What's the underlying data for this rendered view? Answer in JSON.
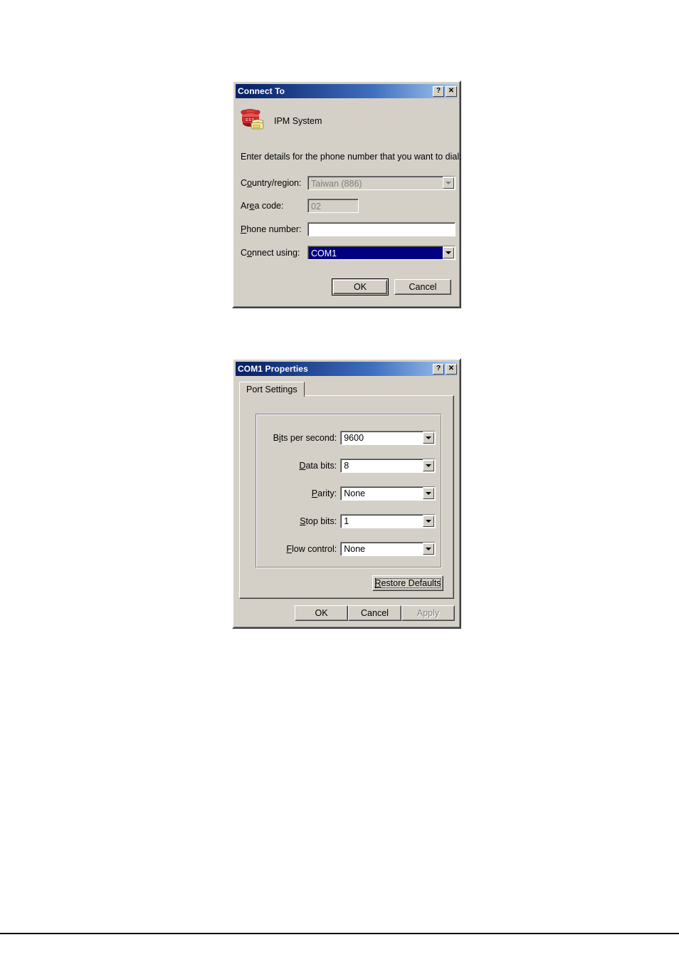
{
  "connect_dialog": {
    "title": "Connect To",
    "help_button": "?",
    "close_button": "✕",
    "icon_name": "telephone-dialup-icon",
    "connection_name": "IPM System",
    "instruction": "Enter details for the phone number that you want to dial:",
    "fields": [
      {
        "name": "country-region",
        "label_before": "C",
        "label_accel": "o",
        "label_after": "untry/region:",
        "value": "Taiwan (886)",
        "control": "combo",
        "state": "disabled"
      },
      {
        "name": "area-code",
        "label_before": "Ar",
        "label_accel": "e",
        "label_after": "a code:",
        "value": "02",
        "control": "text",
        "state": "disabled"
      },
      {
        "name": "phone-number",
        "label_before": "",
        "label_accel": "P",
        "label_after": "hone number:",
        "value": "",
        "control": "text",
        "state": "normal"
      },
      {
        "name": "connect-using",
        "label_before": "C",
        "label_accel": "o",
        "label_after": "nnect using:",
        "value": "COM1",
        "control": "combo",
        "state": "selected"
      }
    ],
    "buttons": [
      {
        "name": "ok",
        "label": "OK",
        "style": "default"
      },
      {
        "name": "cancel",
        "label": "Cancel",
        "style": "normal"
      }
    ]
  },
  "com1_dialog": {
    "title": "COM1 Properties",
    "help_button": "?",
    "close_button": "✕",
    "tabs": [
      {
        "name": "port-settings",
        "label": "Port Settings",
        "active": true
      }
    ],
    "settings": [
      {
        "name": "bits-per-second",
        "label_before": "B",
        "label_accel": "i",
        "label_after": "ts per second:",
        "value": "9600"
      },
      {
        "name": "data-bits",
        "label_before": "",
        "label_accel": "D",
        "label_after": "ata bits:",
        "value": "8"
      },
      {
        "name": "parity",
        "label_before": "",
        "label_accel": "P",
        "label_after": "arity:",
        "value": "None"
      },
      {
        "name": "stop-bits",
        "label_before": "",
        "label_accel": "S",
        "label_after": "top bits:",
        "value": "1"
      },
      {
        "name": "flow-control",
        "label_before": "",
        "label_accel": "F",
        "label_after": "low control:",
        "value": "None"
      }
    ],
    "restore_defaults": {
      "name": "restore-defaults",
      "label_before": "",
      "label_accel": "R",
      "label_after": "estore Defaults",
      "focused": true
    },
    "buttons": [
      {
        "name": "ok",
        "label": "OK",
        "state": "normal"
      },
      {
        "name": "cancel",
        "label": "Cancel",
        "state": "normal"
      },
      {
        "name": "apply",
        "label": "Apply",
        "state": "disabled"
      }
    ]
  },
  "colors": {
    "dialog_face": "#d4d0c8",
    "titlebar_start": "#0a246a",
    "titlebar_end": "#a6caf0",
    "selection": "#000080",
    "disabled_text": "#808080"
  }
}
